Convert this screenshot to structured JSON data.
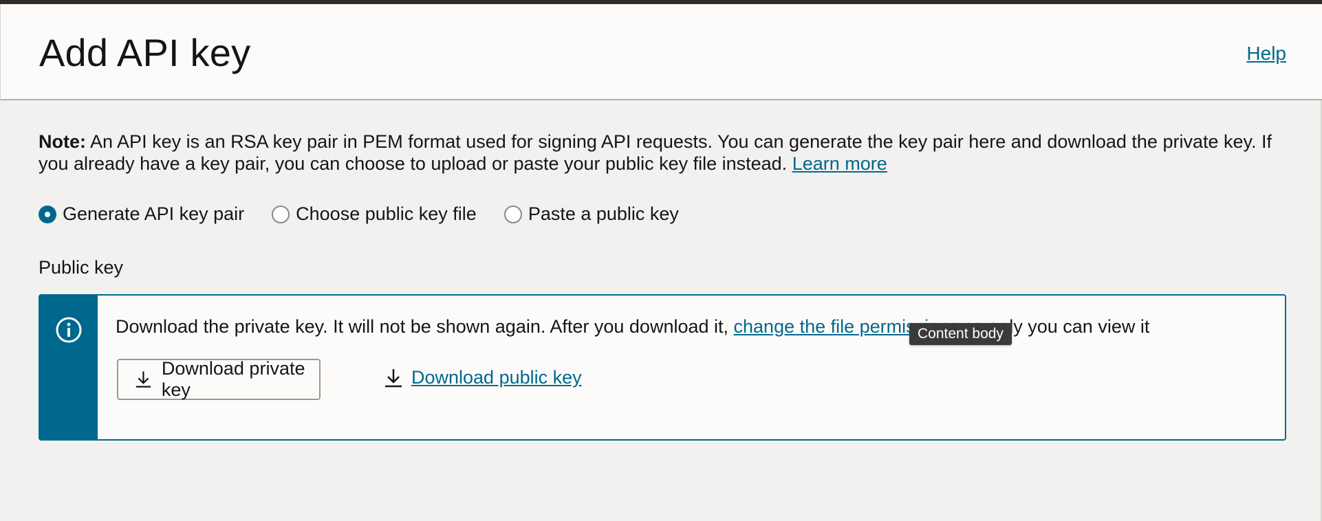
{
  "header": {
    "title": "Add API key",
    "help_label": "Help"
  },
  "note": {
    "prefix": "Note:",
    "text": " An API key is an RSA key pair in PEM format used for signing API requests. You can generate the key pair here and download the private key. If you already have a key pair, you can choose to upload or paste your public key file instead. ",
    "learn_more_label": "Learn more"
  },
  "key_source": {
    "options": [
      {
        "label": "Generate API key pair",
        "selected": true
      },
      {
        "label": "Choose public key file",
        "selected": false
      },
      {
        "label": "Paste a public key",
        "selected": false
      }
    ]
  },
  "public_key": {
    "section_label": "Public key",
    "message_before": "Download the private key. It will not be shown again. After you download it, ",
    "message_link": "change the file permissions",
    "message_after": " so only you can view it",
    "download_private_label": "Download private key",
    "download_public_label": "Download public key"
  },
  "tooltip": {
    "text": "Content body"
  },
  "colors": {
    "accent": "#00688c",
    "topbar": "#312d2a",
    "page_bg": "#f2f1ef",
    "tooltip_bg": "#3a3a3a"
  },
  "icons": {
    "info": "info-circle-icon",
    "download": "download-arrow-icon"
  }
}
